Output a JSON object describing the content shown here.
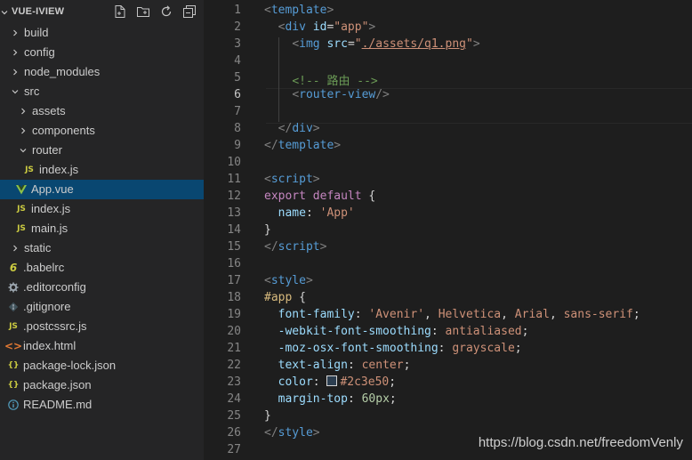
{
  "explorer": {
    "title": "VUE-IVIEW",
    "actions": [
      {
        "icon": "new-file-icon"
      },
      {
        "icon": "new-folder-icon"
      },
      {
        "icon": "refresh-icon"
      },
      {
        "icon": "collapse-all-icon"
      }
    ],
    "tree": [
      {
        "label": "build",
        "kind": "folder",
        "expanded": false,
        "depth": 0
      },
      {
        "label": "config",
        "kind": "folder",
        "expanded": false,
        "depth": 0
      },
      {
        "label": "node_modules",
        "kind": "folder",
        "expanded": false,
        "depth": 0
      },
      {
        "label": "src",
        "kind": "folder",
        "expanded": true,
        "depth": 0
      },
      {
        "label": "assets",
        "kind": "folder",
        "expanded": false,
        "depth": 1
      },
      {
        "label": "components",
        "kind": "folder",
        "expanded": false,
        "depth": 1
      },
      {
        "label": "router",
        "kind": "folder",
        "expanded": true,
        "depth": 1
      },
      {
        "label": "index.js",
        "kind": "js",
        "icon_text": "JS",
        "depth": 2
      },
      {
        "label": "App.vue",
        "kind": "vue",
        "depth": 1,
        "selected": true
      },
      {
        "label": "index.js",
        "kind": "js",
        "icon_text": "JS",
        "depth": 1
      },
      {
        "label": "main.js",
        "kind": "js",
        "icon_text": "JS",
        "depth": 1
      },
      {
        "label": "static",
        "kind": "folder",
        "expanded": false,
        "depth": 0
      },
      {
        "label": ".babelrc",
        "kind": "babel",
        "depth": 0
      },
      {
        "label": ".editorconfig",
        "kind": "gear",
        "depth": 0
      },
      {
        "label": ".gitignore",
        "kind": "git",
        "depth": 0
      },
      {
        "label": ".postcssrc.js",
        "kind": "js",
        "icon_text": "JS",
        "depth": 0
      },
      {
        "label": "index.html",
        "kind": "html",
        "depth": 0
      },
      {
        "label": "package-lock.json",
        "kind": "json",
        "icon_text": "{}",
        "depth": 0
      },
      {
        "label": "package.json",
        "kind": "json",
        "icon_text": "{}",
        "depth": 0
      },
      {
        "label": "README.md",
        "kind": "info",
        "depth": 0
      }
    ]
  },
  "editor": {
    "active_line": 6,
    "lines": [
      {
        "n": "1",
        "tokens": [
          {
            "t": "<",
            "c": "punc"
          },
          {
            "t": "template",
            "c": "tag"
          },
          {
            "t": ">",
            "c": "punc"
          }
        ]
      },
      {
        "n": "2",
        "tokens": [
          {
            "t": "  ",
            "c": "plain"
          },
          {
            "t": "<",
            "c": "punc"
          },
          {
            "t": "div",
            "c": "tag"
          },
          {
            "t": " id",
            "c": "attr"
          },
          {
            "t": "=",
            "c": "plain"
          },
          {
            "t": "\"app\"",
            "c": "str"
          },
          {
            "t": ">",
            "c": "punc"
          }
        ]
      },
      {
        "n": "3",
        "tokens": [
          {
            "t": "    ",
            "c": "plain"
          },
          {
            "t": "<",
            "c": "punc"
          },
          {
            "t": "img",
            "c": "tag"
          },
          {
            "t": " src",
            "c": "attr"
          },
          {
            "t": "=",
            "c": "plain"
          },
          {
            "t": "\"",
            "c": "str"
          },
          {
            "t": "./assets/q1.png",
            "c": "str-u"
          },
          {
            "t": "\"",
            "c": "str"
          },
          {
            "t": ">",
            "c": "punc"
          }
        ]
      },
      {
        "n": "4",
        "tokens": []
      },
      {
        "n": "5",
        "tokens": [
          {
            "t": "    ",
            "c": "plain"
          },
          {
            "t": "<!-- 路由 -->",
            "c": "cm"
          }
        ]
      },
      {
        "n": "6",
        "tokens": [
          {
            "t": "    ",
            "c": "plain"
          },
          {
            "t": "<",
            "c": "punc"
          },
          {
            "t": "router-view",
            "c": "tag"
          },
          {
            "t": "/>",
            "c": "punc"
          }
        ]
      },
      {
        "n": "7",
        "tokens": []
      },
      {
        "n": "8",
        "tokens": [
          {
            "t": "  ",
            "c": "plain"
          },
          {
            "t": "</",
            "c": "punc"
          },
          {
            "t": "div",
            "c": "tag"
          },
          {
            "t": ">",
            "c": "punc"
          }
        ]
      },
      {
        "n": "9",
        "tokens": [
          {
            "t": "</",
            "c": "punc"
          },
          {
            "t": "template",
            "c": "tag"
          },
          {
            "t": ">",
            "c": "punc"
          }
        ]
      },
      {
        "n": "10",
        "tokens": []
      },
      {
        "n": "11",
        "tokens": [
          {
            "t": "<",
            "c": "punc"
          },
          {
            "t": "script",
            "c": "tag"
          },
          {
            "t": ">",
            "c": "punc"
          }
        ]
      },
      {
        "n": "12",
        "tokens": [
          {
            "t": "export",
            "c": "kw"
          },
          {
            "t": " ",
            "c": "plain"
          },
          {
            "t": "default",
            "c": "kw"
          },
          {
            "t": " {",
            "c": "plain"
          }
        ]
      },
      {
        "n": "13",
        "tokens": [
          {
            "t": "  ",
            "c": "plain"
          },
          {
            "t": "name",
            "c": "prop"
          },
          {
            "t": ": ",
            "c": "plain"
          },
          {
            "t": "'App'",
            "c": "str"
          }
        ]
      },
      {
        "n": "14",
        "tokens": [
          {
            "t": "}",
            "c": "plain"
          }
        ]
      },
      {
        "n": "15",
        "tokens": [
          {
            "t": "</",
            "c": "punc"
          },
          {
            "t": "script",
            "c": "tag"
          },
          {
            "t": ">",
            "c": "punc"
          }
        ]
      },
      {
        "n": "16",
        "tokens": []
      },
      {
        "n": "17",
        "tokens": [
          {
            "t": "<",
            "c": "punc"
          },
          {
            "t": "style",
            "c": "tag"
          },
          {
            "t": ">",
            "c": "punc"
          }
        ]
      },
      {
        "n": "18",
        "tokens": [
          {
            "t": "#app",
            "c": "sel"
          },
          {
            "t": " {",
            "c": "plain"
          }
        ]
      },
      {
        "n": "19",
        "tokens": [
          {
            "t": "  ",
            "c": "plain"
          },
          {
            "t": "font-family",
            "c": "prop"
          },
          {
            "t": ": ",
            "c": "plain"
          },
          {
            "t": "'Avenir'",
            "c": "val"
          },
          {
            "t": ", ",
            "c": "plain"
          },
          {
            "t": "Helvetica",
            "c": "val"
          },
          {
            "t": ", ",
            "c": "plain"
          },
          {
            "t": "Arial",
            "c": "val"
          },
          {
            "t": ", ",
            "c": "plain"
          },
          {
            "t": "sans-serif",
            "c": "val"
          },
          {
            "t": ";",
            "c": "plain"
          }
        ]
      },
      {
        "n": "20",
        "tokens": [
          {
            "t": "  ",
            "c": "plain"
          },
          {
            "t": "-webkit-font-smoothing",
            "c": "prop"
          },
          {
            "t": ": ",
            "c": "plain"
          },
          {
            "t": "antialiased",
            "c": "val"
          },
          {
            "t": ";",
            "c": "plain"
          }
        ]
      },
      {
        "n": "21",
        "tokens": [
          {
            "t": "  ",
            "c": "plain"
          },
          {
            "t": "-moz-osx-font-smoothing",
            "c": "prop"
          },
          {
            "t": ": ",
            "c": "plain"
          },
          {
            "t": "grayscale",
            "c": "val"
          },
          {
            "t": ";",
            "c": "plain"
          }
        ]
      },
      {
        "n": "22",
        "tokens": [
          {
            "t": "  ",
            "c": "plain"
          },
          {
            "t": "text-align",
            "c": "prop"
          },
          {
            "t": ": ",
            "c": "plain"
          },
          {
            "t": "center",
            "c": "val"
          },
          {
            "t": ";",
            "c": "plain"
          }
        ]
      },
      {
        "n": "23",
        "tokens": [
          {
            "t": "  ",
            "c": "plain"
          },
          {
            "t": "color",
            "c": "prop"
          },
          {
            "t": ": ",
            "c": "plain"
          },
          {
            "t": "",
            "c": "swatch",
            "color": "#2c3e50"
          },
          {
            "t": "#2c3e50",
            "c": "val"
          },
          {
            "t": ";",
            "c": "plain"
          }
        ]
      },
      {
        "n": "24",
        "tokens": [
          {
            "t": "  ",
            "c": "plain"
          },
          {
            "t": "margin-top",
            "c": "prop"
          },
          {
            "t": ": ",
            "c": "plain"
          },
          {
            "t": "60px",
            "c": "num"
          },
          {
            "t": ";",
            "c": "plain"
          }
        ]
      },
      {
        "n": "25",
        "tokens": [
          {
            "t": "}",
            "c": "plain"
          }
        ]
      },
      {
        "n": "26",
        "tokens": [
          {
            "t": "</",
            "c": "punc"
          },
          {
            "t": "style",
            "c": "tag"
          },
          {
            "t": ">",
            "c": "punc"
          }
        ]
      },
      {
        "n": "27",
        "tokens": []
      }
    ]
  },
  "watermark": "https://blog.csdn.net/freedomVenly",
  "colors": {
    "selection": "#094771",
    "sidebar_bg": "#252526",
    "editor_bg": "#1e1e1e",
    "js_icon": "#cbcb41",
    "vue_icon": "#8dc149",
    "json_icon": "#cbcb41",
    "html_icon": "#e37933",
    "babel_icon": "#cbcb41",
    "info_icon": "#519aba"
  }
}
